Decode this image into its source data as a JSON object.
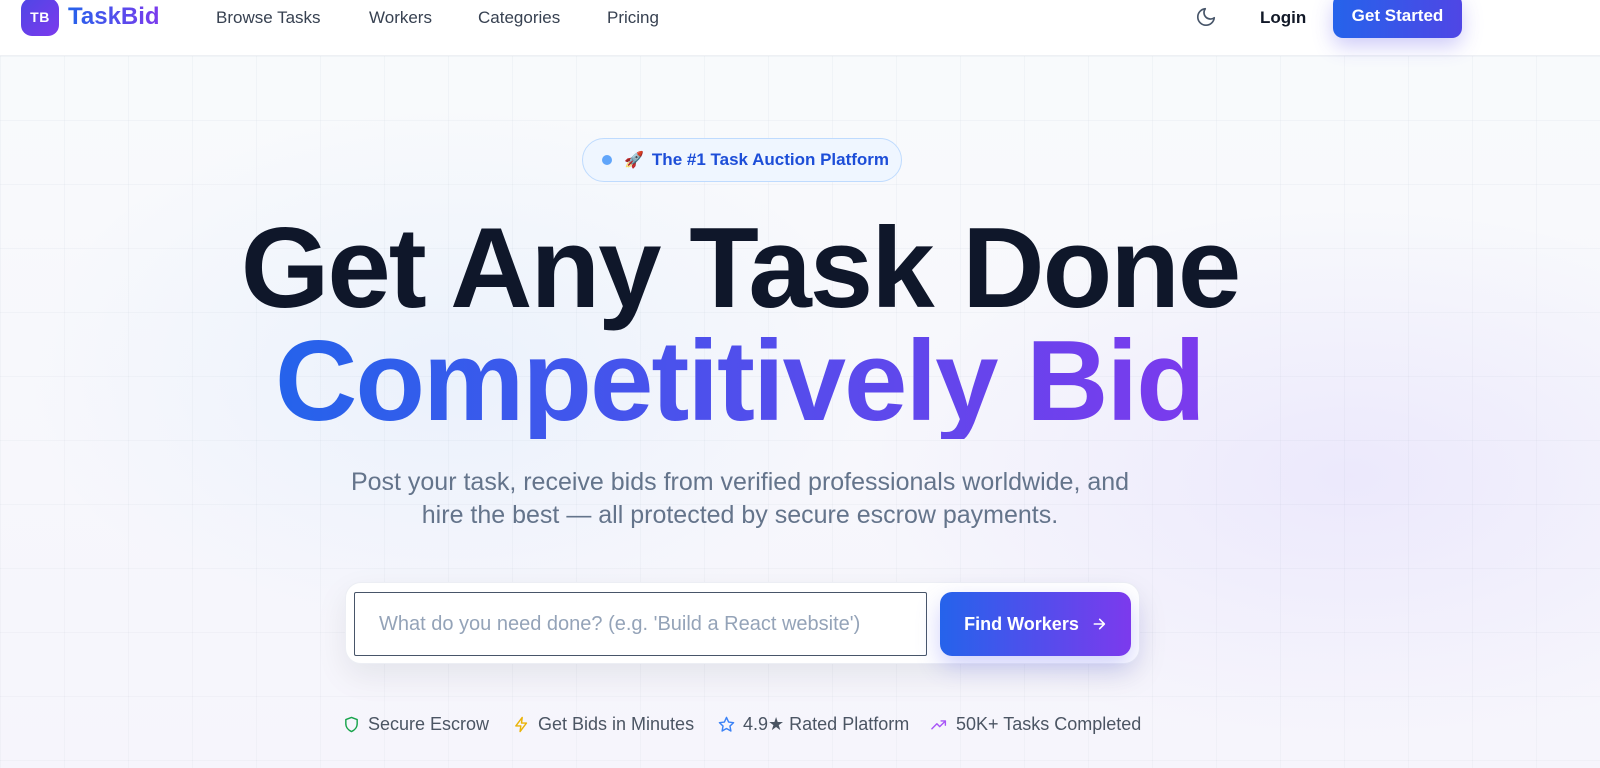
{
  "brand": {
    "badge": "TB",
    "name": "TaskBid"
  },
  "nav": {
    "links": [
      "Browse Tasks",
      "Workers",
      "Categories",
      "Pricing"
    ],
    "login": "Login",
    "cta": "Get Started"
  },
  "hero": {
    "pill_emoji": "🚀",
    "pill_text": "The #1 Task Auction Platform",
    "title_line1": "Get Any Task Done",
    "title_line2": "Competitively Bid",
    "subtitle_line1": "Post your task, receive bids from verified professionals worldwide, and",
    "subtitle_line2": "hire the best — all protected by secure escrow payments."
  },
  "search": {
    "placeholder": "What do you need done? (e.g. 'Build a React website')",
    "value": "",
    "button": "Find Workers"
  },
  "features": [
    {
      "icon": "shield-icon",
      "label": "Secure Escrow",
      "color": "#16a34a"
    },
    {
      "icon": "lightning-icon",
      "label": "Get Bids in Minutes",
      "color": "#eab308"
    },
    {
      "icon": "star-icon",
      "label": "4.9★ Rated Platform",
      "color": "#3b82f6"
    },
    {
      "icon": "trending-up-icon",
      "label": "50K+ Tasks Completed",
      "color": "#a855f7"
    }
  ],
  "colors": {
    "brand_blue": "#2563eb",
    "brand_purple": "#7c3aed",
    "headline": "#0f172a",
    "muted": "#64748b"
  }
}
